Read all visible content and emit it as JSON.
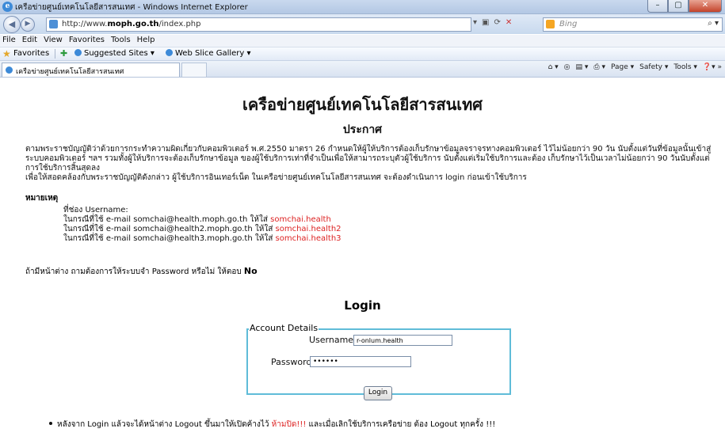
{
  "window": {
    "title": "เครือข่ายศูนย์เทคโนโลยีสารสนเทศ - Windows Internet Explorer",
    "controls": [
      "–",
      "▢",
      "✕"
    ]
  },
  "address": {
    "url_prefix": "http://www.",
    "url_host": "moph.go.th",
    "url_path": "/index.php",
    "search_engine": "Bing"
  },
  "menu": [
    "File",
    "Edit",
    "View",
    "Favorites",
    "Tools",
    "Help"
  ],
  "favorites": {
    "label": "Favorites",
    "links": [
      "Suggested Sites ▾",
      "Web Slice Gallery ▾"
    ]
  },
  "tab": {
    "title": "เครือข่ายศูนย์เทคโนโลยีสารสนเทศ"
  },
  "commands": [
    "Page ▾",
    "Safety ▾",
    "Tools ▾"
  ],
  "page": {
    "site_title": "เครือข่ายศูนย์เทคโนโลยีสารสนเทศ",
    "announcement": "ประกาศ",
    "para1": "ตามพระราชบัญญัติว่าด้วยการกระทำความผิดเกี่ยวกับคอมพิวเตอร์ พ.ศ.2550 มาตรา 26 กำหนดให้ผู้ให้บริการต้องเก็บรักษาข้อมูลจราจรทางคอมพิวเตอร์ ไว้ไม่น้อยกว่า 90 วัน นับตั้งแต่วันที่ข้อมูลนั้นเข้าสู่ระบบคอมพิวเตอร์ ฯลฯ รวมทั้งผู้ให้บริการจะต้องเก็บรักษาข้อมูล ของผู้ใช้บริการเท่าที่จำเป็นเพื่อให้สามารถระบุตัวผู้ใช้บริการ นับตั้งแต่เริ่มใช้บริการและต้อง เก็บรักษาไว้เป็นเวลาไม่น้อยกว่า 90 วันนับตั้งแต่การใช้บริการสิ้นสุดลง",
    "para2": "เพื่อให้สอดคล้องกับพระราชบัญญัติดังกล่าว ผู้ใช้บริการอินเทอร์เน็ต ในเครือข่ายศูนย์เทคโนโลยีสารสนเทศ จะต้องดำเนินการ login ก่อนเข้าใช้บริการ",
    "note_head": "หมายเหตุ",
    "username_heading": "ที่ช่อง Username:",
    "cases": [
      {
        "text": "ในกรณีที่ใช้ e-mail somchai@health.moph.go.th ให้ใส่ ",
        "value": "somchai.health"
      },
      {
        "text": "ในกรณีที่ใช้ e-mail somchai@health2.moph.go.th ให้ใส่ ",
        "value": "somchai.health2"
      },
      {
        "text": "ในกรณีที่ใช้ e-mail somchai@health3.moph.go.th ให้ใส่ ",
        "value": "somchai.health3"
      }
    ],
    "popup_question": "ถ้ามีหน้าต่าง ถามต้องการให้ระบบจำ Password หรือไม่ ให้ตอบ ",
    "popup_answer": "No",
    "login_heading": "Login",
    "legend": "Account Details",
    "username_label": "Username:",
    "username_value": "r-onlum.health",
    "password_label": "Password:",
    "password_value": "••••••",
    "login_button": "Login",
    "footer_pre": "หลังจาก Login แล้วจะได้หน้าต่าง Logout ขึ้นมาให้เปิดค้างไว้ ",
    "footer_warn": "ห้ามปิด!!!",
    "footer_post": " และเมื่อเลิกใช้บริการเครือข่าย ต้อง Logout ทุกครั้ง !!!"
  },
  "colors": {
    "accent_red": "#d22222",
    "fieldset_border": "#5fbcd8"
  }
}
